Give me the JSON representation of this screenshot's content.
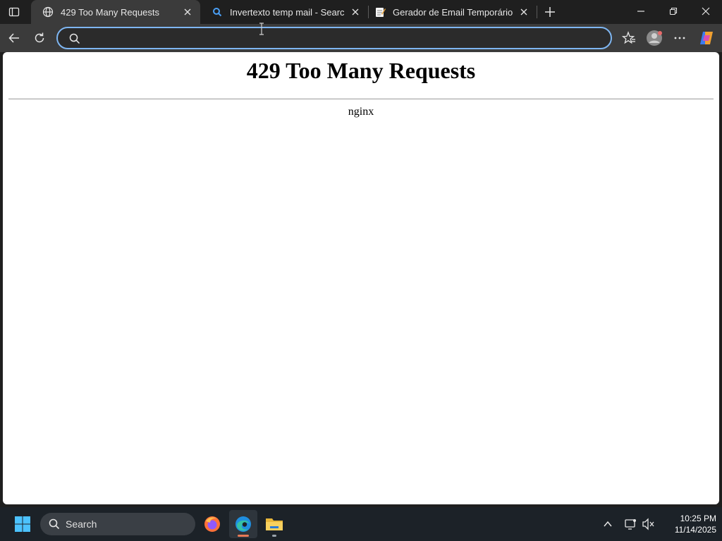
{
  "browser": {
    "tabs": [
      {
        "title": "429 Too Many Requests",
        "favicon": "globe-icon",
        "active": true
      },
      {
        "title": "Invertexto temp mail - Search",
        "favicon": "search-icon",
        "active": false
      },
      {
        "title": "Gerador de Email Temporário | inv",
        "favicon": "memo-icon",
        "active": false
      }
    ],
    "address_bar": {
      "value": "",
      "placeholder": ""
    },
    "colors": {
      "accent": "#7eb6f2",
      "chrome_dark": "#1f1f1f",
      "toolbar": "#3b3b3b"
    }
  },
  "page": {
    "heading": "429 Too Many Requests",
    "server": "nginx"
  },
  "taskbar": {
    "search_label": "Search",
    "apps": [
      "firefox-icon",
      "edge-icon",
      "file-explorer-icon"
    ],
    "clock": {
      "time": "10:25 PM",
      "date": "11/14/2025"
    }
  }
}
